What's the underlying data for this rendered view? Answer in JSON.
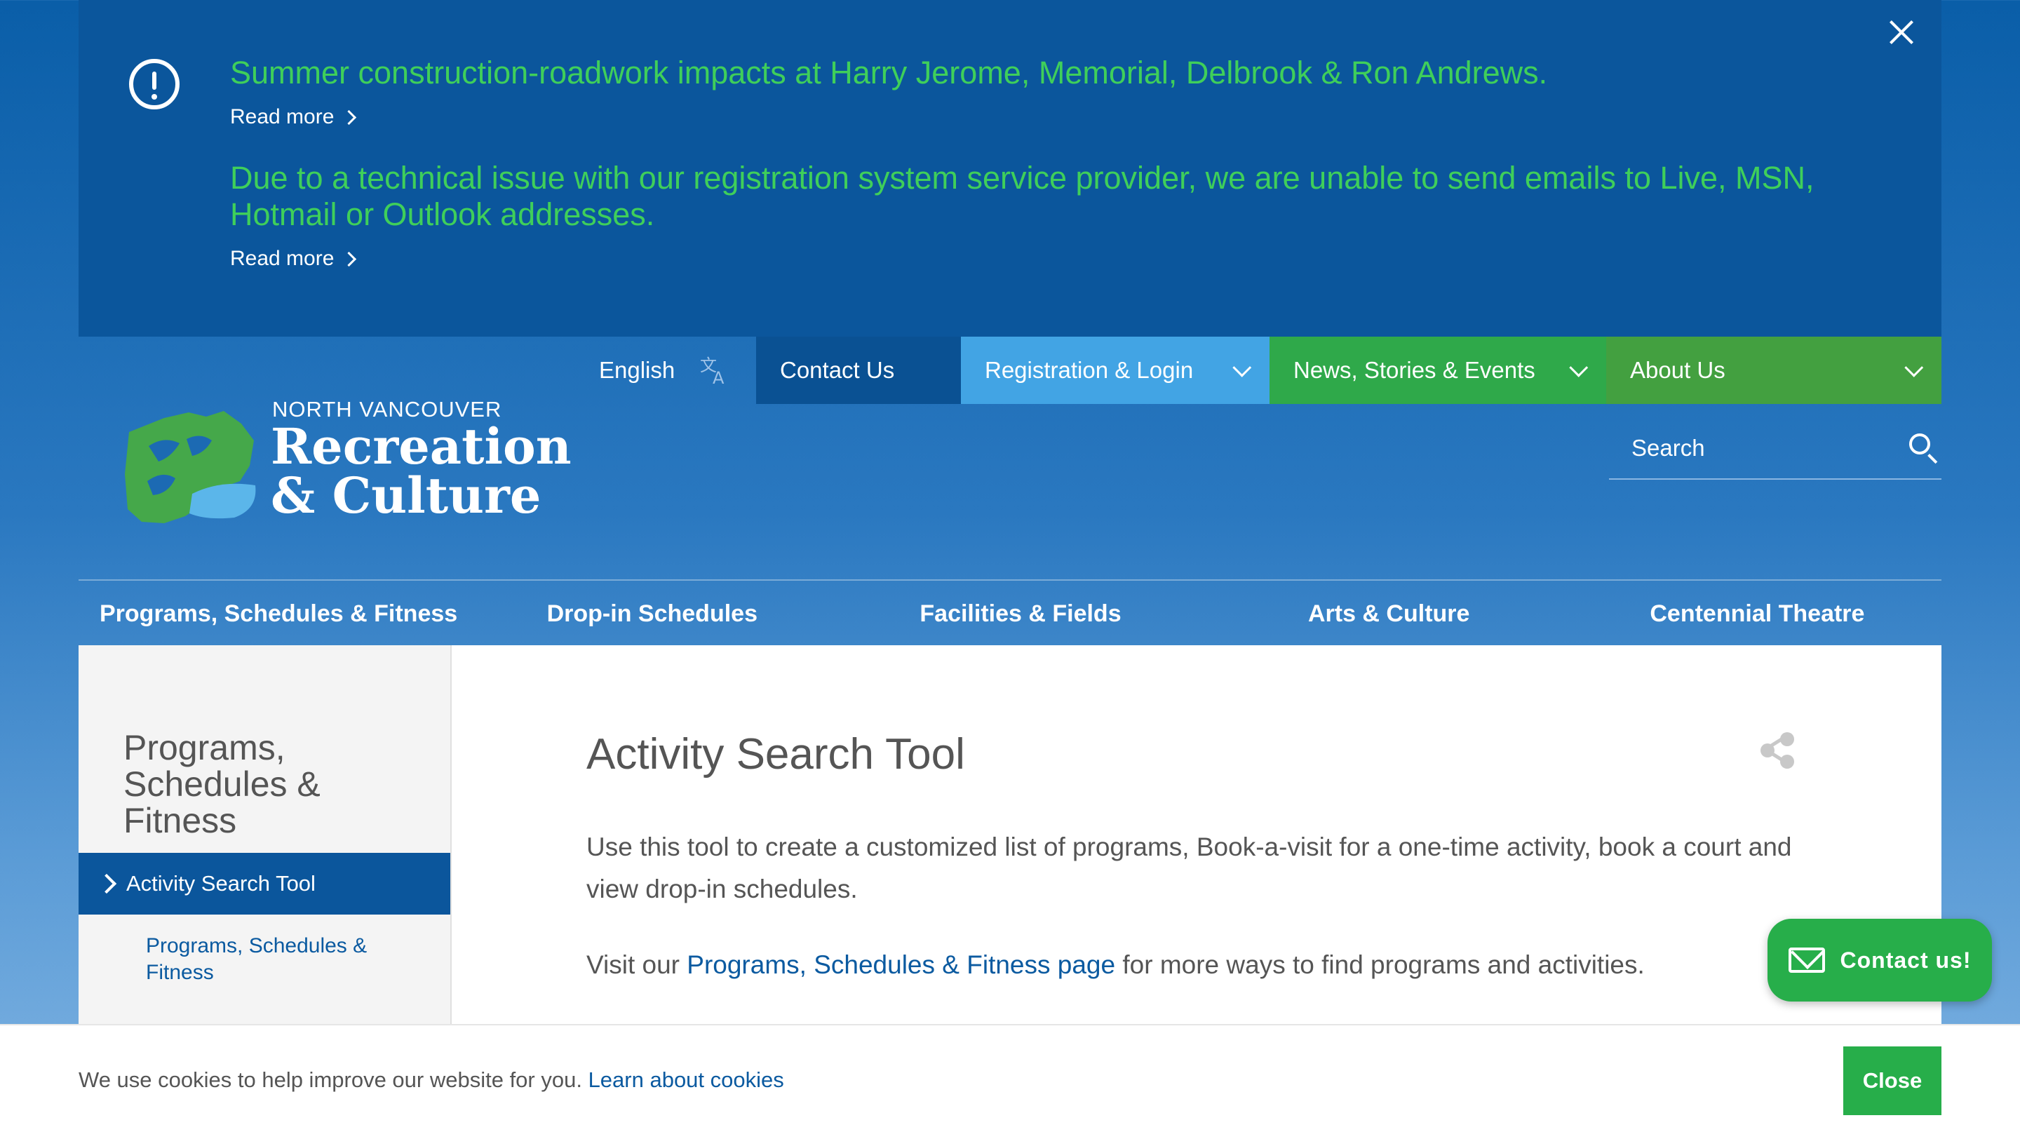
{
  "alert": {
    "messages": [
      {
        "text": "Summer construction-roadwork impacts at Harry Jerome, Memorial, Delbrook & Ron Andrews.",
        "link": "Read more"
      },
      {
        "text": "Due to a technical issue with our registration system service provider, we are unable to send emails to Live, MSN, Hotmail or Outlook addresses.",
        "link": "Read more"
      }
    ]
  },
  "utility_nav": {
    "language": "English",
    "contact": "Contact Us",
    "registration": "Registration & Login",
    "news": "News, Stories & Events",
    "about": "About Us"
  },
  "logo": {
    "line1": "NORTH VANCOUVER",
    "line2": "Recreation",
    "line3": "& Culture"
  },
  "search": {
    "placeholder": "Search"
  },
  "main_nav": [
    "Programs, Schedules & Fitness",
    "Drop-in Schedules",
    "Facilities & Fields",
    "Arts & Culture",
    "Centennial Theatre"
  ],
  "sidebar": {
    "title": "Programs, Schedules & Fitness",
    "active": "Activity Search Tool",
    "sub": "Programs, Schedules & Fitness"
  },
  "page": {
    "title": "Activity Search Tool",
    "intro": "Use this tool to create a customized list of programs, Book-a-visit for a one-time activity, book a court and view drop-in schedules.",
    "visit_prefix": "Visit our ",
    "visit_link": "Programs, Schedules & Fitness page",
    "visit_suffix": " for more ways to find programs and activities."
  },
  "contact_widget": {
    "label": "Contact us!"
  },
  "cookie": {
    "text": "We use cookies to help improve our website for you. ",
    "link": "Learn about cookies",
    "close": "Close"
  },
  "colors": {
    "alert_bg": "#0b569c",
    "alert_text": "#3fcf5a",
    "contact_tab": "#0a5193",
    "registration_tab": "#42a4e4",
    "news_tab": "#2fa94a",
    "about_tab": "#43a040",
    "accent_green": "#27ae4a",
    "link_blue": "#0b5aa0"
  }
}
